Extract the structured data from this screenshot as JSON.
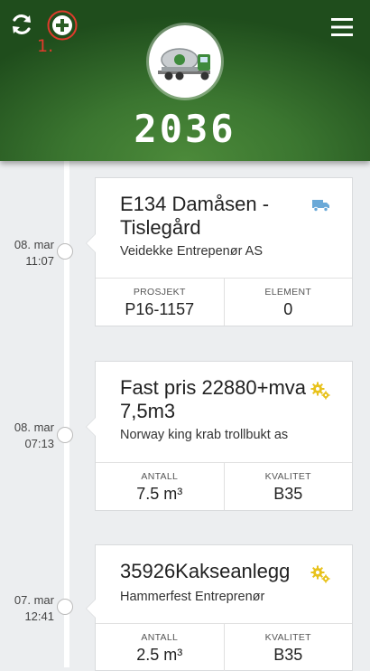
{
  "header": {
    "vehicle_number": "2036",
    "annotation": "1.",
    "colors": {
      "accent": "#3b7630",
      "annotation": "#e03b2c"
    }
  },
  "icons": {
    "refresh": "refresh-icon",
    "add": "add-circle-icon",
    "menu": "hamburger-menu-icon",
    "avatar": "concrete-mixer-truck-icon"
  },
  "entries": [
    {
      "date": "08. mar",
      "time": "11:07",
      "title": "E134 Damåsen - Tislegård",
      "subtitle": "Veidekke Entrepenør AS",
      "icon": "truck-icon",
      "icon_color": "#6aa9d8",
      "fields": [
        {
          "label": "PROSJEKT",
          "value": "P16-1157"
        },
        {
          "label": "ELEMENT",
          "value": "0"
        }
      ]
    },
    {
      "date": "08. mar",
      "time": "07:13",
      "title": "Fast pris 22880+mva 7,5m3",
      "subtitle": "Norway king krab trollbukt as",
      "icon": "gears-icon",
      "icon_color": "#e8c21c",
      "fields": [
        {
          "label": "ANTALL",
          "value": "7.5 m³"
        },
        {
          "label": "KVALITET",
          "value": "B35"
        }
      ]
    },
    {
      "date": "07. mar",
      "time": "12:41",
      "title": "35926Kakseanlegg",
      "subtitle": "Hammerfest Entreprenør",
      "icon": "gears-icon",
      "icon_color": "#e8c21c",
      "fields": [
        {
          "label": "ANTALL",
          "value": "2.5 m³"
        },
        {
          "label": "KVALITET",
          "value": "B35"
        }
      ]
    }
  ]
}
